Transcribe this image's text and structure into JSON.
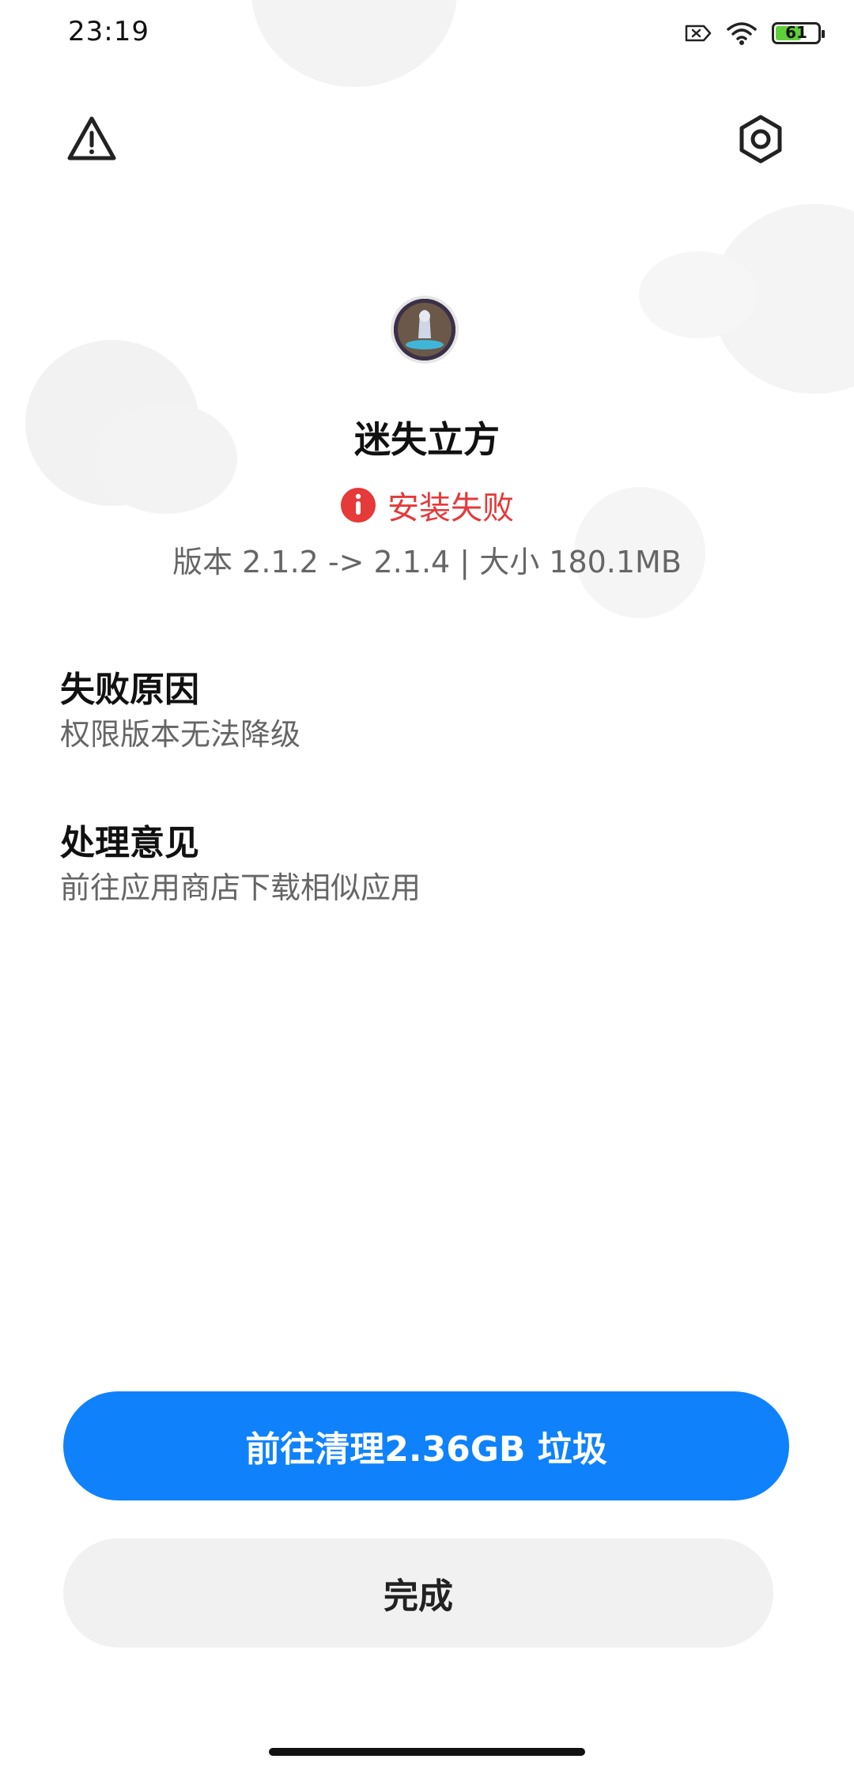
{
  "status_bar": {
    "time": "23:19",
    "battery_level": "61"
  },
  "app": {
    "name": "迷失立方"
  },
  "install": {
    "status": "安装失败",
    "version_info": "版本 2.1.2 -> 2.1.4 | 大小 180.1MB"
  },
  "failure": {
    "title": "失败原因",
    "text": "权限版本无法降级"
  },
  "suggestion": {
    "title": "处理意见",
    "text": "前往应用商店下载相似应用"
  },
  "buttons": {
    "clean": "前往清理2.36GB 垃圾",
    "done": "完成"
  },
  "colors": {
    "accent": "#0f82fb",
    "error": "#e5393a",
    "battery": "#5fcf3a"
  },
  "icons": [
    "warning-icon",
    "settings-icon",
    "sim-error-icon",
    "wifi-icon",
    "battery-icon",
    "error-info-icon"
  ]
}
